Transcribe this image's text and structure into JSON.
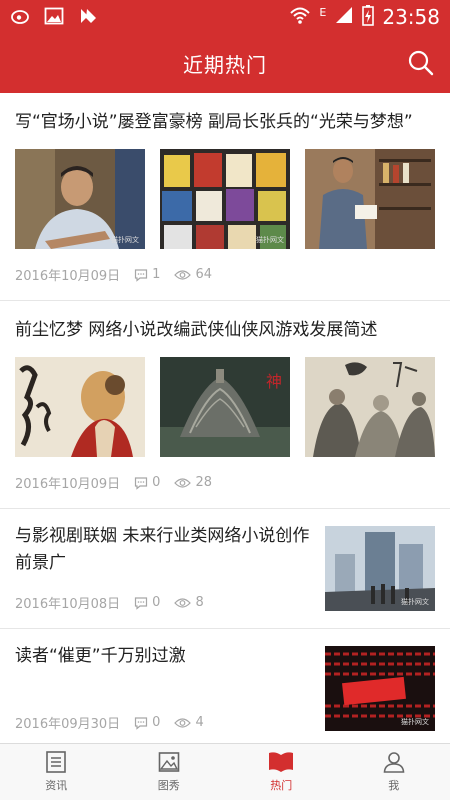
{
  "status_bar": {
    "time": "23:58",
    "network_type": "E",
    "left_icons": [
      "weibo-icon",
      "gallery-icon",
      "app-icon"
    ],
    "right_icons": [
      "wifi-icon",
      "signal-icon",
      "battery-charging-icon"
    ]
  },
  "header": {
    "title": "近期热门",
    "search_icon": "search-icon"
  },
  "articles": [
    {
      "title": "写“官场小说”屡登富豪榜 副局长张兵的“光荣与梦想”",
      "date": "2016年10月09日",
      "comments": "1",
      "views": "64",
      "layout": "three-images"
    },
    {
      "title": "前尘忆梦 网络小说改编武侠仙侠风游戏发展简述",
      "date": "2016年10月09日",
      "comments": "0",
      "views": "28",
      "layout": "three-images"
    },
    {
      "title": "与影视剧联姻 未来行业类网络小说创作前景广",
      "date": "2016年10月08日",
      "comments": "0",
      "views": "8",
      "layout": "single-image"
    },
    {
      "title": "读者“催更”千万别过激",
      "date": "2016年09月30日",
      "comments": "0",
      "views": "4",
      "layout": "single-image"
    }
  ],
  "tabs": [
    {
      "label": "资讯",
      "icon": "news-icon",
      "active": false
    },
    {
      "label": "图秀",
      "icon": "image-icon",
      "active": false
    },
    {
      "label": "热门",
      "icon": "book-icon",
      "active": true
    },
    {
      "label": "我",
      "icon": "user-icon",
      "active": false
    }
  ],
  "colors": {
    "brand_red": "#d32f2f",
    "meta_gray": "#a6a6a6",
    "tab_gray": "#666666"
  }
}
